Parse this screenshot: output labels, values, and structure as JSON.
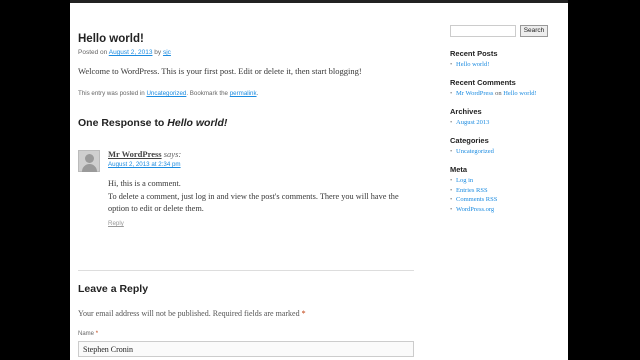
{
  "post": {
    "title": "Hello world!",
    "posted_on": "Posted on",
    "date": "August 2, 2013",
    "by": "by",
    "author": "sjc",
    "content": "Welcome to WordPress. This is your first post. Edit or delete it, then start blogging!",
    "footer_prefix": "This entry was posted in",
    "category": "Uncategorized",
    "footer_mid": ". Bookmark the",
    "permalink": "permalink",
    "footer_end": "."
  },
  "comments": {
    "title_prefix": "One Response to",
    "title_post": "Hello world!",
    "comment": {
      "author": "Mr WordPress",
      "says": "says:",
      "date": "August 2, 2013 at 2:34 pm",
      "line1": "Hi, this is a comment.",
      "line2": "To delete a comment, just log in and view the post's comments. There you will have the option to edit or delete them.",
      "reply": "Reply"
    }
  },
  "reply_form": {
    "title": "Leave a Reply",
    "notes": "Your email address will not be published. Required fields are marked",
    "required_mark": "*",
    "name_label": "Name",
    "name_value": "Stephen Cronin"
  },
  "sidebar": {
    "search_button": "Search",
    "recent_posts": {
      "title": "Recent Posts",
      "items": [
        "Hello world!"
      ]
    },
    "recent_comments": {
      "title": "Recent Comments",
      "author": "Mr WordPress",
      "on": "on",
      "post": "Hello world!"
    },
    "archives": {
      "title": "Archives",
      "items": [
        "August 2013"
      ]
    },
    "categories": {
      "title": "Categories",
      "items": [
        "Uncategorized"
      ]
    },
    "meta": {
      "title": "Meta",
      "items": [
        "Log in",
        "Entries RSS",
        "Comments RSS",
        "WordPress.org"
      ]
    }
  }
}
